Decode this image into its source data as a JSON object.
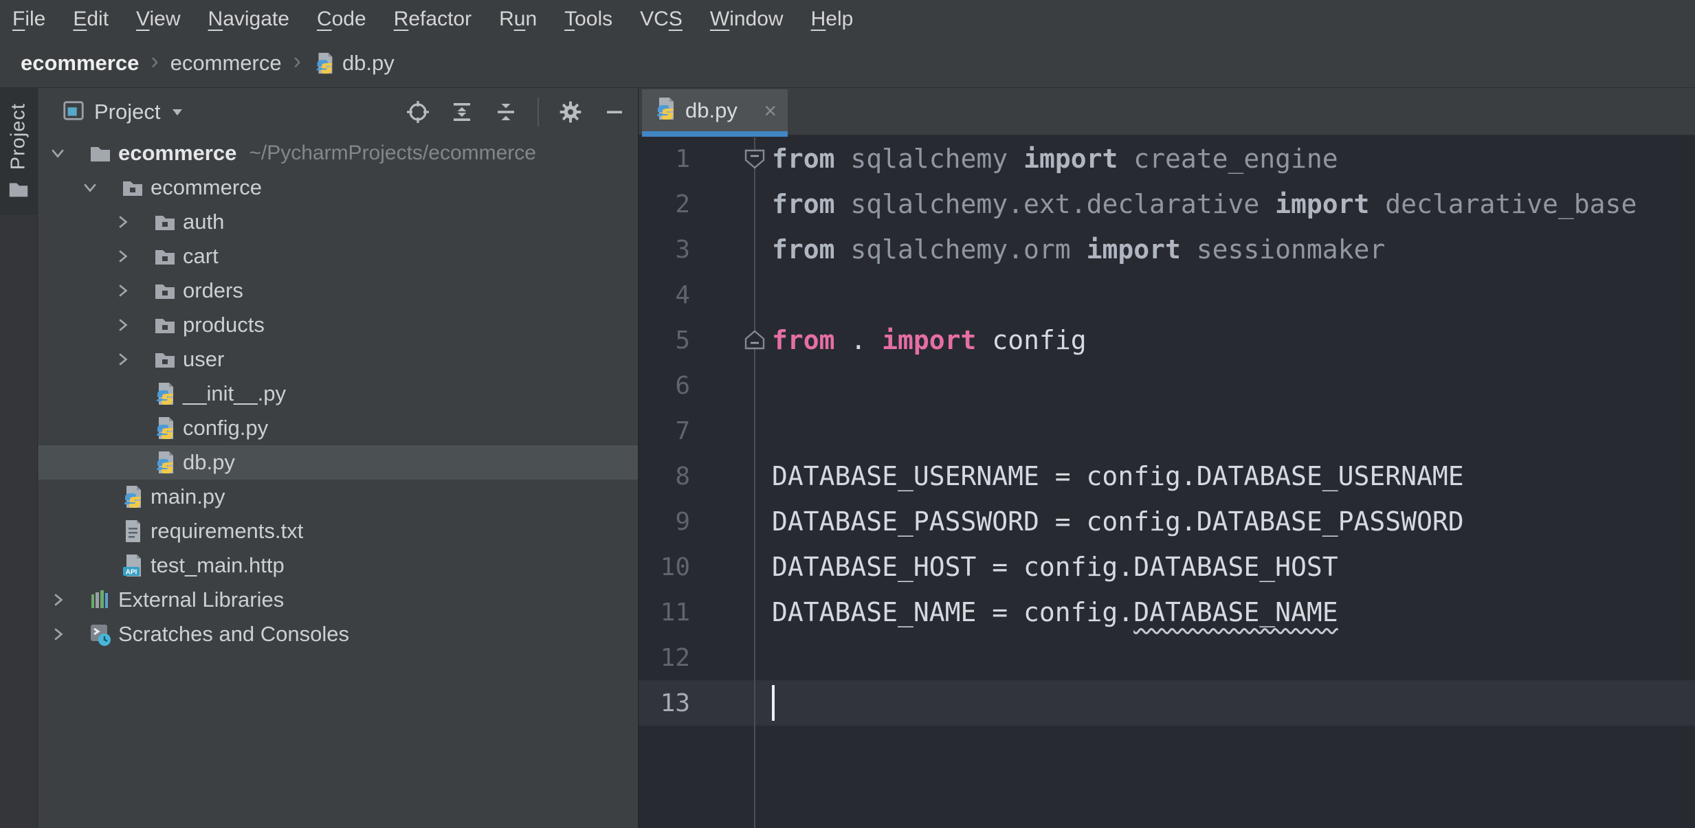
{
  "menu": {
    "items": [
      {
        "label": "File",
        "u": 0
      },
      {
        "label": "Edit",
        "u": 0
      },
      {
        "label": "View",
        "u": 0
      },
      {
        "label": "Navigate",
        "u": 0
      },
      {
        "label": "Code",
        "u": 0
      },
      {
        "label": "Refactor",
        "u": 0
      },
      {
        "label": "Run",
        "u": 1
      },
      {
        "label": "Tools",
        "u": 0
      },
      {
        "label": "VCS",
        "u": 2
      },
      {
        "label": "Window",
        "u": 0
      },
      {
        "label": "Help",
        "u": 0
      }
    ]
  },
  "breadcrumbs": {
    "separator": "›",
    "items": [
      {
        "label": "ecommerce",
        "bold": true
      },
      {
        "label": "ecommerce",
        "bold": false
      },
      {
        "label": "db.py",
        "bold": false,
        "icon": "python"
      }
    ]
  },
  "left_stripe": {
    "project_tab_label": "Project"
  },
  "project_panel": {
    "header": {
      "title": "Project",
      "toolbar_icons": [
        "locate",
        "expand-all",
        "collapse-all",
        "divider",
        "settings",
        "hide"
      ]
    },
    "tree": [
      {
        "label": "ecommerce",
        "suffix": "~/PycharmProjects/ecommerce",
        "icon": "folder",
        "level": 1,
        "chevron": "expanded",
        "bold": true
      },
      {
        "label": "ecommerce",
        "icon": "package",
        "level": 2,
        "chevron": "expanded"
      },
      {
        "label": "auth",
        "icon": "package",
        "level": 3,
        "chevron": "collapsed"
      },
      {
        "label": "cart",
        "icon": "package",
        "level": 3,
        "chevron": "collapsed"
      },
      {
        "label": "orders",
        "icon": "package",
        "level": 3,
        "chevron": "collapsed"
      },
      {
        "label": "products",
        "icon": "package",
        "level": 3,
        "chevron": "collapsed"
      },
      {
        "label": "user",
        "icon": "package",
        "level": 3,
        "chevron": "collapsed"
      },
      {
        "label": "__init__.py",
        "icon": "python",
        "level": 3
      },
      {
        "label": "config.py",
        "icon": "python",
        "level": 3
      },
      {
        "label": "db.py",
        "icon": "python",
        "level": 3,
        "selected": true
      },
      {
        "label": "main.py",
        "icon": "python",
        "level": 2
      },
      {
        "label": "requirements.txt",
        "icon": "text",
        "level": 2
      },
      {
        "label": "test_main.http",
        "icon": "http",
        "level": 2
      },
      {
        "label": "External Libraries",
        "icon": "libraries",
        "level": 1,
        "chevron": "collapsed"
      },
      {
        "label": "Scratches and Consoles",
        "icon": "scratches",
        "level": 1,
        "chevron": "collapsed"
      }
    ]
  },
  "editor": {
    "tab": {
      "label": "db.py",
      "close_glyph": "×"
    },
    "code": {
      "lines": [
        {
          "n": 1,
          "fold": "start",
          "seg": [
            [
              "kg",
              "from"
            ],
            [
              "g",
              " sqlalchemy "
            ],
            [
              "kg",
              "import"
            ],
            [
              "g",
              " create_engine"
            ]
          ]
        },
        {
          "n": 2,
          "seg": [
            [
              "kg",
              "from"
            ],
            [
              "g",
              " sqlalchemy.ext.declarative "
            ],
            [
              "kg",
              "import"
            ],
            [
              "g",
              " declarative_base"
            ]
          ]
        },
        {
          "n": 3,
          "seg": [
            [
              "kg",
              "from"
            ],
            [
              "g",
              " sqlalchemy.orm "
            ],
            [
              "kg",
              "import"
            ],
            [
              "g",
              " sessionmaker"
            ]
          ]
        },
        {
          "n": 4,
          "seg": []
        },
        {
          "n": 5,
          "fold": "end",
          "seg": [
            [
              "kp",
              "from"
            ],
            [
              "w",
              " . "
            ],
            [
              "kp",
              "import"
            ],
            [
              "w",
              " config"
            ]
          ]
        },
        {
          "n": 6,
          "seg": []
        },
        {
          "n": 7,
          "seg": []
        },
        {
          "n": 8,
          "seg": [
            [
              "w",
              "DATABASE_USERNAME = config.DATABASE_USERNAME"
            ]
          ]
        },
        {
          "n": 9,
          "seg": [
            [
              "w",
              "DATABASE_PASSWORD = config.DATABASE_PASSWORD"
            ]
          ]
        },
        {
          "n": 10,
          "seg": [
            [
              "w",
              "DATABASE_HOST = config.DATABASE_HOST"
            ]
          ]
        },
        {
          "n": 11,
          "seg": [
            [
              "w",
              "DATABASE_NAME = config."
            ],
            [
              "err",
              "DATABASE_NAME"
            ]
          ]
        },
        {
          "n": 12,
          "seg": []
        },
        {
          "n": 13,
          "seg": [],
          "current": true,
          "caret": true
        }
      ]
    }
  },
  "colors": {
    "tab_underline_blue": "#4186c4",
    "keyword_pink": "#e56fa4",
    "code_text": "#d6dae0",
    "muted_import_text": "#9097a0",
    "selected_row": "#4b5053",
    "current_line": "#31343d",
    "editor_bg": "#282a32",
    "panel_bg": "#3d4043"
  }
}
